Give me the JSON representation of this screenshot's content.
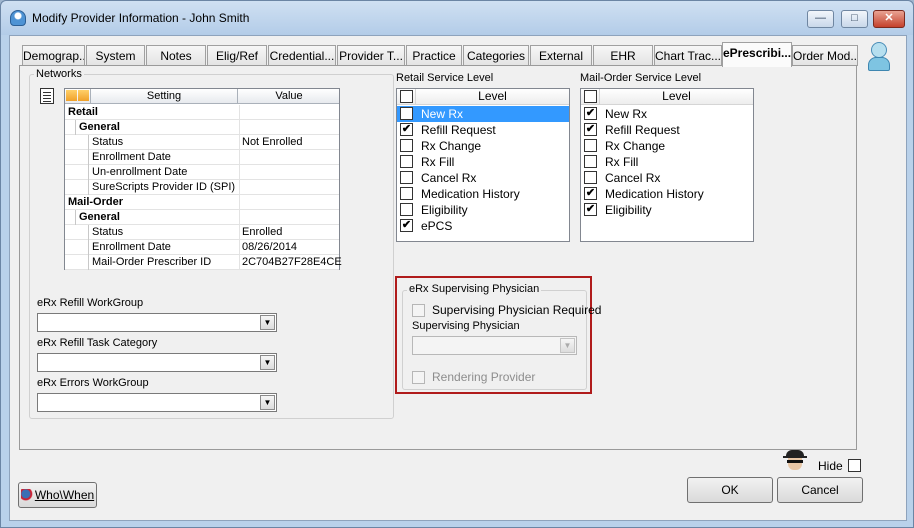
{
  "window": {
    "title": "Modify Provider Information - John Smith",
    "buttons": {
      "minimize": "—",
      "maximize": "□",
      "close": "✕"
    }
  },
  "tabs": [
    {
      "label": "Demograp..."
    },
    {
      "label": "System"
    },
    {
      "label": "Notes"
    },
    {
      "label": "Elig/Ref"
    },
    {
      "label": "Credential..."
    },
    {
      "label": "Provider T..."
    },
    {
      "label": "Practice"
    },
    {
      "label": "Categories"
    },
    {
      "label": "External"
    },
    {
      "label": "EHR"
    },
    {
      "label": "Chart Trac..."
    },
    {
      "label": "ePrescribi..."
    },
    {
      "label": "Order Mod..."
    }
  ],
  "active_tab": "ePrescribi...",
  "networks": {
    "label": "Networks",
    "columns": {
      "setting": "Setting",
      "value": "Value"
    },
    "rows": [
      {
        "setting": "Retail",
        "value": "",
        "level": 0,
        "kind": "cat"
      },
      {
        "setting": "General",
        "value": "",
        "level": 1,
        "kind": "sub"
      },
      {
        "setting": "Status",
        "value": "Not Enrolled",
        "level": 2,
        "kind": "item"
      },
      {
        "setting": "Enrollment Date",
        "value": "",
        "level": 2,
        "kind": "item"
      },
      {
        "setting": "Un-enrollment Date",
        "value": "",
        "level": 2,
        "kind": "item"
      },
      {
        "setting": "SureScripts Provider ID (SPI)",
        "value": "",
        "level": 2,
        "kind": "item"
      },
      {
        "setting": "Mail-Order",
        "value": "",
        "level": 0,
        "kind": "cat"
      },
      {
        "setting": "General",
        "value": "",
        "level": 1,
        "kind": "sub"
      },
      {
        "setting": "Status",
        "value": "Enrolled",
        "level": 2,
        "kind": "item"
      },
      {
        "setting": "Enrollment Date",
        "value": "08/26/2014",
        "level": 2,
        "kind": "item"
      },
      {
        "setting": "Mail-Order Prescriber ID",
        "value": "2C704B27F28E4CE",
        "level": 2,
        "kind": "item"
      }
    ]
  },
  "workgroups": {
    "refill_label": "eRx Refill WorkGroup",
    "refill_value": "",
    "task_label": "eRx Refill Task Category",
    "task_value": "",
    "errors_label": "eRx Errors WorkGroup",
    "errors_value": ""
  },
  "retail": {
    "label": "Retail Service Level",
    "header": "Level",
    "header_checked": false,
    "items": [
      {
        "label": "New Rx",
        "checked": true,
        "selected": true
      },
      {
        "label": "Refill Request",
        "checked": true,
        "selected": false
      },
      {
        "label": "Rx Change",
        "checked": false,
        "selected": false
      },
      {
        "label": "Rx Fill",
        "checked": false,
        "selected": false
      },
      {
        "label": "Cancel Rx",
        "checked": false,
        "selected": false
      },
      {
        "label": "Medication History",
        "checked": false,
        "selected": false
      },
      {
        "label": "Eligibility",
        "checked": false,
        "selected": false
      },
      {
        "label": "ePCS",
        "checked": true,
        "selected": false
      }
    ]
  },
  "mailorder": {
    "label": "Mail-Order Service Level",
    "header": "Level",
    "header_checked": false,
    "items": [
      {
        "label": "New Rx",
        "checked": true,
        "selected": false
      },
      {
        "label": "Refill Request",
        "checked": true,
        "selected": false
      },
      {
        "label": "Rx Change",
        "checked": false,
        "selected": false
      },
      {
        "label": "Rx Fill",
        "checked": false,
        "selected": false
      },
      {
        "label": "Cancel Rx",
        "checked": false,
        "selected": false
      },
      {
        "label": "Medication History",
        "checked": true,
        "selected": false
      },
      {
        "label": "Eligibility",
        "checked": true,
        "selected": false
      }
    ]
  },
  "supervising": {
    "label": "eRx Supervising Physician",
    "required_label": "Supervising Physician Required",
    "required_checked": false,
    "physician_label": "Supervising Physician",
    "physician_value": "",
    "rendering_label": "Rendering Provider",
    "rendering_checked": false
  },
  "footer": {
    "hide_label": "Hide",
    "hide_checked": false,
    "whowhen_label": "Who\\When",
    "ok_label": "OK",
    "cancel_label": "Cancel"
  },
  "colors": {
    "selection": "#3399ff",
    "highlight_border": "#b01b1b",
    "window_frame": "#b9d1ea"
  }
}
